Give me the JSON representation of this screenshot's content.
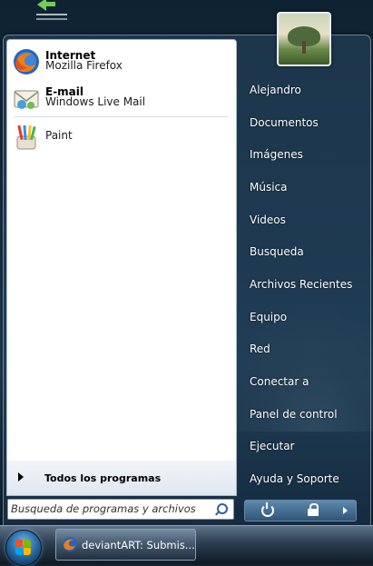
{
  "programs": {
    "pinned": [
      {
        "title": "Internet",
        "subtitle": "Mozilla Firefox",
        "icon": "firefox-icon"
      },
      {
        "title": "E-mail",
        "subtitle": "Windows Live Mail",
        "icon": "mail-icon"
      }
    ],
    "recent": [
      {
        "title": "Paint",
        "icon": "paint-icon"
      }
    ]
  },
  "all_programs_label": "Todos los programas",
  "search": {
    "placeholder": "Busqueda de programas y archivos",
    "value": ""
  },
  "right_panel": {
    "items": [
      "Alejandro",
      "Documentos",
      "Imágenes",
      "Música",
      "Videos",
      "Busqueda",
      "Archivos Recientes",
      "Equipo",
      "Red",
      "Conectar a",
      "Panel de control",
      "Ejecutar",
      "Ayuda y Soporte"
    ]
  },
  "taskbar": {
    "task_label": "deviantART: Submis...",
    "task_icon": "firefox-icon"
  },
  "colors": {
    "accent_green": "#6fcf5a",
    "menu_glass": "#2d5576",
    "text_white": "#ffffff"
  }
}
